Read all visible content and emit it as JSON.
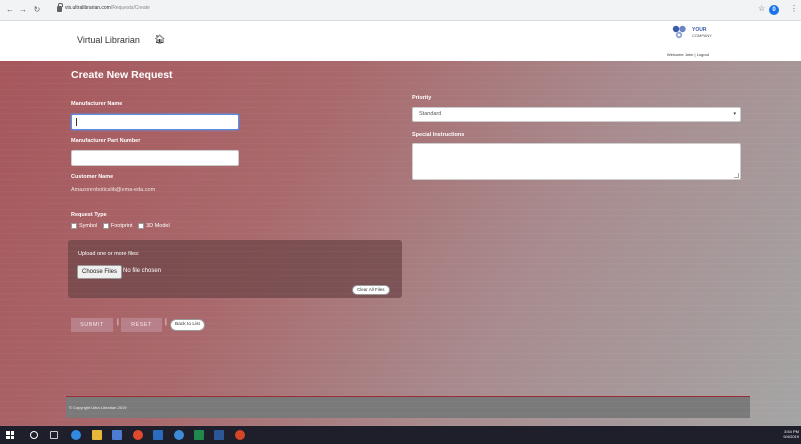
{
  "browser": {
    "url_domain": "vis.ultralibrarian.com",
    "url_path": "/Requests/Create",
    "profile_initial": "0"
  },
  "header": {
    "site_title": "Virtual Librarian",
    "logo_line1": "YOUR",
    "logo_line2": "COMPANY",
    "welcome": "Welcome John",
    "separator": "|",
    "logout": "Logout"
  },
  "form": {
    "title": "Create New Request",
    "manufacturer_name_label": "Manufacturer Name",
    "manufacturer_name_value": "",
    "part_number_label": "Manufacturer Part Number",
    "part_number_value": "",
    "customer_name_label": "Customer Name",
    "customer_name_value": "Amazonroboticslib@ema-eda.com",
    "priority_label": "Priority",
    "priority_selected": "Standard",
    "special_instructions_label": "Special Instructions",
    "special_instructions_value": "",
    "request_type_label": "Request Type",
    "request_types": [
      "Symbol",
      "Footprint",
      "3D Model"
    ]
  },
  "upload": {
    "label": "Upload one or more files:",
    "choose_button": "Choose Files",
    "status": "No file chosen",
    "clear_button": "Clear All Files"
  },
  "actions": {
    "submit": "SUBMIT",
    "reset": "RESET",
    "back": "Back to List",
    "pipe": "|"
  },
  "footer": {
    "copyright": "© Copyright Ultra Librarian 2019"
  },
  "taskbar": {
    "time": "3:54 PM",
    "date": "9/4/2019"
  }
}
